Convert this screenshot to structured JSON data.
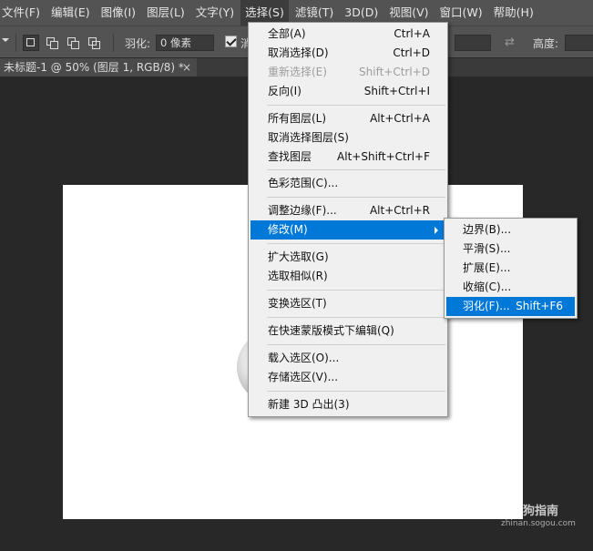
{
  "menubar": {
    "items": [
      "文件(F)",
      "编辑(E)",
      "图像(I)",
      "图层(L)",
      "文字(Y)",
      "选择(S)",
      "滤镜(T)",
      "3D(D)",
      "视图(V)",
      "窗口(W)",
      "帮助(H)"
    ]
  },
  "options": {
    "feather_label": "羽化:",
    "feather_value": "0 像素",
    "antialias_label": "消",
    "height_label": "高度:"
  },
  "tab": {
    "title": "未标题-1 @ 50% (图层 1, RGB/8) *",
    "close": "×"
  },
  "select_menu": {
    "items": [
      {
        "label": "全部(A)",
        "shortcut": "Ctrl+A"
      },
      {
        "label": "取消选择(D)",
        "shortcut": "Ctrl+D"
      },
      {
        "label": "重新选择(E)",
        "shortcut": "Shift+Ctrl+D",
        "disabled": true
      },
      {
        "label": "反向(I)",
        "shortcut": "Shift+Ctrl+I"
      },
      {
        "label": "所有图层(L)",
        "shortcut": "Alt+Ctrl+A"
      },
      {
        "label": "取消选择图层(S)",
        "shortcut": ""
      },
      {
        "label": "查找图层",
        "shortcut": "Alt+Shift+Ctrl+F"
      },
      {
        "label": "色彩范围(C)...",
        "shortcut": ""
      },
      {
        "label": "调整边缘(F)...",
        "shortcut": "Alt+Ctrl+R"
      },
      {
        "label": "修改(M)",
        "shortcut": "",
        "highlighted": true,
        "submenu": true
      },
      {
        "label": "扩大选取(G)",
        "shortcut": ""
      },
      {
        "label": "选取相似(R)",
        "shortcut": ""
      },
      {
        "label": "变换选区(T)",
        "shortcut": ""
      },
      {
        "label": "在快速蒙版模式下编辑(Q)",
        "shortcut": ""
      },
      {
        "label": "载入选区(O)...",
        "shortcut": ""
      },
      {
        "label": "存储选区(V)...",
        "shortcut": ""
      },
      {
        "label": "新建 3D 凸出(3)",
        "shortcut": ""
      }
    ]
  },
  "modify_submenu": {
    "items": [
      {
        "label": "边界(B)...",
        "shortcut": ""
      },
      {
        "label": "平滑(S)...",
        "shortcut": ""
      },
      {
        "label": "扩展(E)...",
        "shortcut": ""
      },
      {
        "label": "收缩(C)...",
        "shortcut": ""
      },
      {
        "label": "羽化(F)...",
        "shortcut": "Shift+F6",
        "highlighted": true
      }
    ]
  },
  "watermark": {
    "brand": "搜狗指南",
    "url": "zhinan.sogou.com"
  },
  "colors": {
    "menubar_bg": "#535353",
    "workspace_bg": "#282828",
    "menu_bg": "#f0f0f0",
    "highlight": "#0078d7"
  }
}
